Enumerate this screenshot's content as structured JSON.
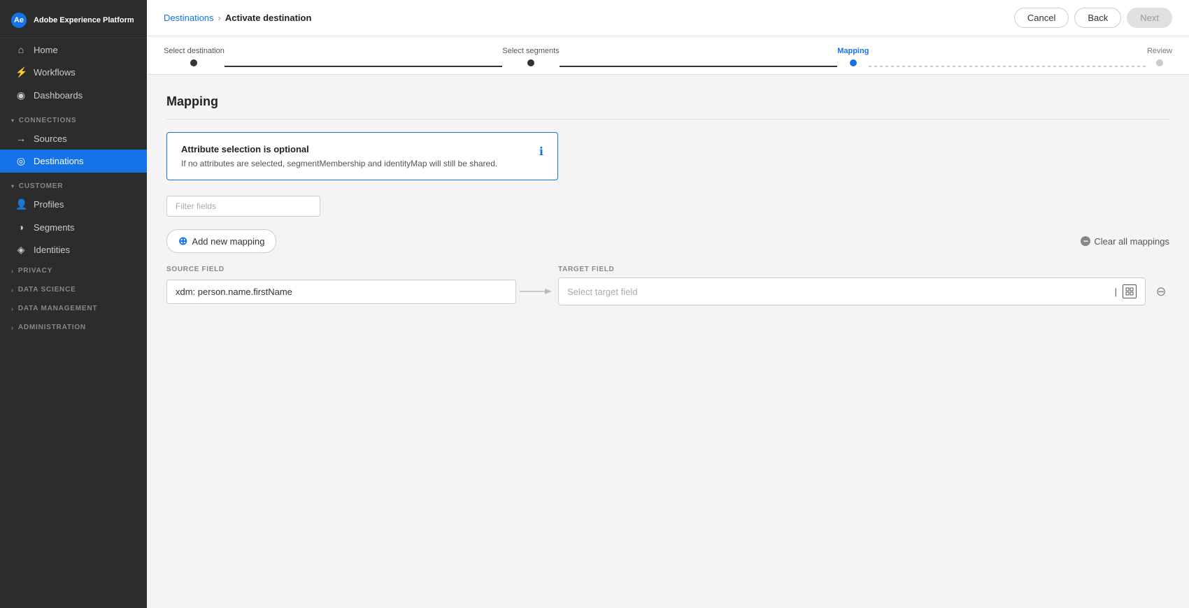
{
  "sidebar": {
    "logo_label": "Adobe Experience Platform",
    "nav_items": [
      {
        "id": "home",
        "label": "Home",
        "icon": "⌂",
        "active": false
      },
      {
        "id": "workflows",
        "label": "Workflows",
        "icon": "⚡",
        "active": false
      },
      {
        "id": "dashboards",
        "label": "Dashboards",
        "icon": "◉",
        "active": false
      }
    ],
    "sections": [
      {
        "id": "connections",
        "label": "CONNECTIONS",
        "expanded": true,
        "items": [
          {
            "id": "sources",
            "label": "Sources",
            "icon": "→",
            "active": false
          },
          {
            "id": "destinations",
            "label": "Destinations",
            "icon": "◎",
            "active": true
          }
        ]
      },
      {
        "id": "customer",
        "label": "CUSTOMER",
        "expanded": true,
        "items": [
          {
            "id": "profiles",
            "label": "Profiles",
            "icon": "👤",
            "active": false
          },
          {
            "id": "segments",
            "label": "Segments",
            "icon": "◑",
            "active": false
          },
          {
            "id": "identities",
            "label": "Identities",
            "icon": "◈",
            "active": false
          }
        ]
      },
      {
        "id": "privacy",
        "label": "PRIVACY",
        "expanded": false,
        "items": []
      },
      {
        "id": "data_science",
        "label": "DATA SCIENCE",
        "expanded": false,
        "items": []
      },
      {
        "id": "data_management",
        "label": "DATA MANAGEMENT",
        "expanded": false,
        "items": []
      },
      {
        "id": "administration",
        "label": "ADMINISTRATION",
        "expanded": false,
        "items": []
      }
    ]
  },
  "topbar": {
    "breadcrumb": {
      "parent": "Destinations",
      "separator": "›",
      "current": "Activate destination"
    },
    "buttons": {
      "cancel": "Cancel",
      "back": "Back",
      "next": "Next"
    }
  },
  "steps": [
    {
      "id": "select-destination",
      "label": "Select destination",
      "state": "done"
    },
    {
      "id": "select-segments",
      "label": "Select segments",
      "state": "done"
    },
    {
      "id": "mapping",
      "label": "Mapping",
      "state": "active"
    },
    {
      "id": "review",
      "label": "Review",
      "state": "pending"
    }
  ],
  "page": {
    "title": "Mapping",
    "info_box": {
      "title": "Attribute selection is optional",
      "description": "If no attributes are selected, segmentMembership and identityMap will still be shared."
    },
    "filter_placeholder": "Filter fields",
    "add_mapping_label": "Add new mapping",
    "clear_mappings_label": "Clear all mappings",
    "source_field_label": "SOURCE FIELD",
    "target_field_label": "TARGET FIELD",
    "mapping_row": {
      "source_value": "xdm: person.name.firstName",
      "target_placeholder": "Select target field"
    }
  }
}
